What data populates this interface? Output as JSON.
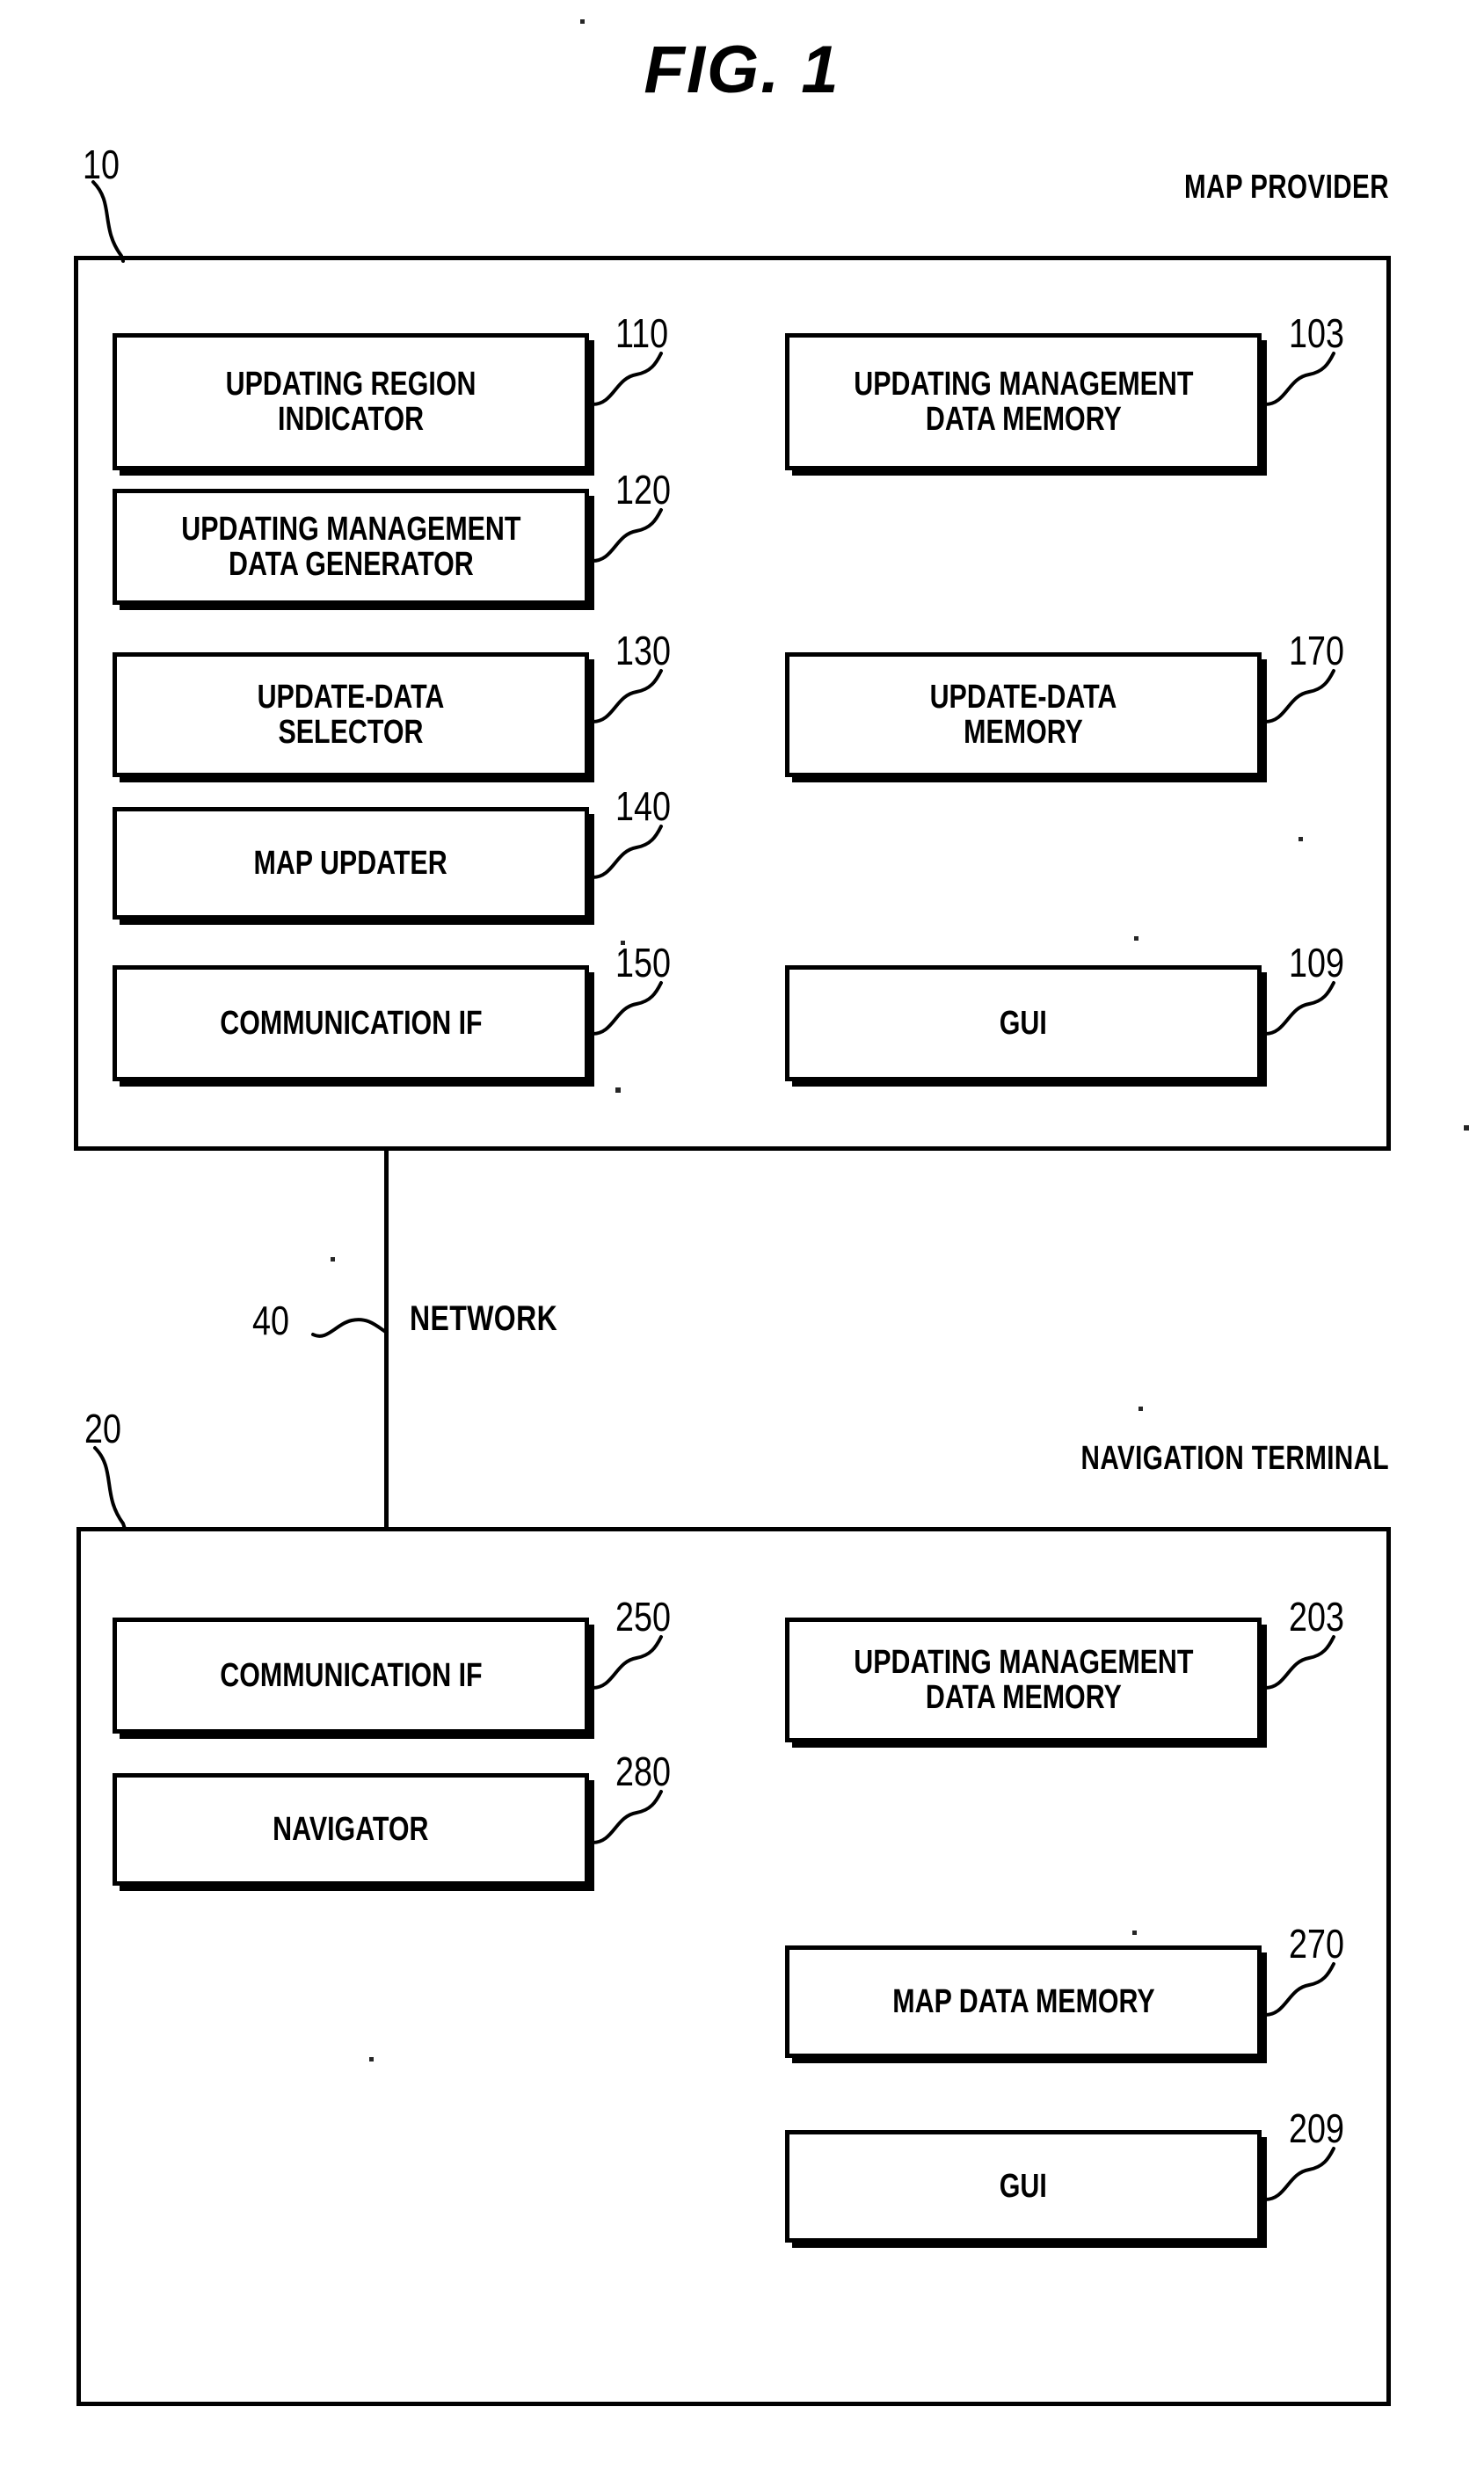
{
  "figure": {
    "title": "FIG. 1"
  },
  "map_provider": {
    "caption": "MAP PROVIDER",
    "ref": "10",
    "blocks": [
      {
        "label": "UPDATING REGION\nINDICATOR",
        "ref": "110"
      },
      {
        "label": "UPDATING MANAGEMENT\nDATA GENERATOR",
        "ref": "120"
      },
      {
        "label": "UPDATE-DATA\nSELECTOR",
        "ref": "130"
      },
      {
        "label": "MAP UPDATER",
        "ref": "140"
      },
      {
        "label": "COMMUNICATION IF",
        "ref": "150"
      },
      {
        "label": "UPDATING MANAGEMENT\nDATA MEMORY",
        "ref": "103"
      },
      {
        "label": "UPDATE-DATA\nMEMORY",
        "ref": "170"
      },
      {
        "label": "GUI",
        "ref": "109"
      }
    ]
  },
  "network": {
    "label": "NETWORK",
    "ref": "40"
  },
  "navigation_terminal": {
    "caption": "NAVIGATION TERMINAL",
    "ref": "20",
    "blocks": [
      {
        "label": "COMMUNICATION IF",
        "ref": "250"
      },
      {
        "label": "NAVIGATOR",
        "ref": "280"
      },
      {
        "label": "UPDATING MANAGEMENT\nDATA MEMORY",
        "ref": "203"
      },
      {
        "label": "MAP DATA MEMORY",
        "ref": "270"
      },
      {
        "label": "GUI",
        "ref": "209"
      }
    ]
  },
  "colors": {
    "ink": "#000000",
    "paper": "#ffffff"
  }
}
